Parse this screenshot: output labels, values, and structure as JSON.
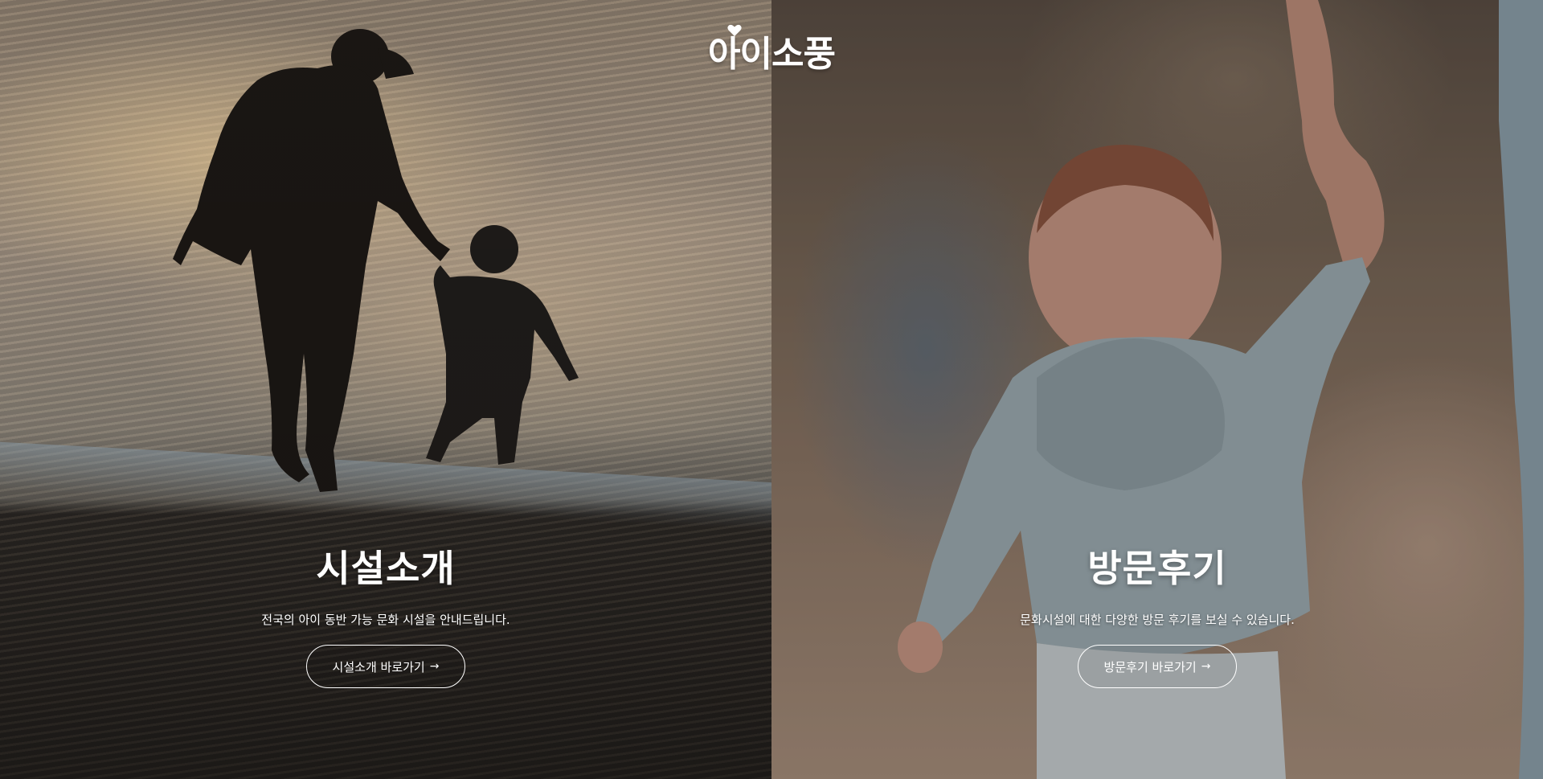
{
  "brand": {
    "logo_text": "아이소풍",
    "logo_icon": "heart-icon"
  },
  "panels": [
    {
      "title": "시설소개",
      "description": "전국의 아이 동반 가능 문화 시설을 안내드립니다.",
      "button_label": "시설소개 바로가기",
      "button_icon": "arrow-right-icon",
      "arrow": "→"
    },
    {
      "title": "방문후기",
      "description": "문화시설에 대한 다양한 방문 후기를 보실 수 있습니다.",
      "button_label": "방문후기 바로가기",
      "button_icon": "arrow-right-icon",
      "arrow": "→"
    }
  ],
  "colors": {
    "text": "#ffffff",
    "button_border": "#ffffff"
  }
}
